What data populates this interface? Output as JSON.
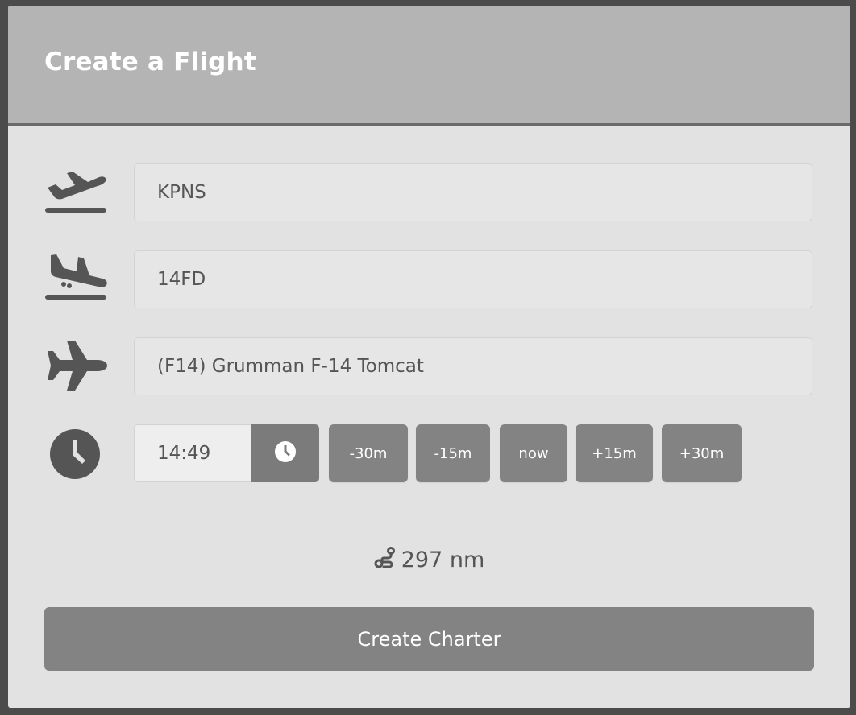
{
  "header": {
    "title": "Create a Flight"
  },
  "form": {
    "departure": {
      "icon": "plane-departure-icon",
      "value": "KPNS"
    },
    "arrival": {
      "icon": "plane-arrival-icon",
      "value": "14FD"
    },
    "aircraft": {
      "icon": "plane-icon",
      "value": "(F14) Grumman F-14 Tomcat"
    },
    "time": {
      "icon": "clock-icon",
      "value": "14:49",
      "picker_icon": "clock-icon",
      "quick_buttons": [
        "-30m",
        "-15m",
        "now",
        "+15m",
        "+30m"
      ]
    }
  },
  "distance": {
    "icon": "route-icon",
    "value": "297 nm"
  },
  "submit": {
    "label": "Create Charter"
  },
  "colors": {
    "header_bg": "#b4b4b4",
    "card_bg": "#e2e2e2",
    "button_bg": "#838383",
    "icon": "#555555"
  }
}
